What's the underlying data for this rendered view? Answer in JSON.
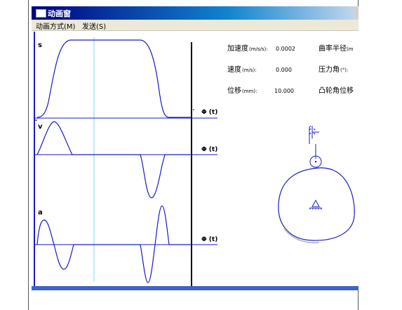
{
  "window": {
    "title": "动画窗"
  },
  "menu": {
    "items": [
      "动画方式(M)",
      "发送(S)"
    ]
  },
  "graphs": {
    "s_label": "s",
    "v_label": "v",
    "a_label": "a",
    "axis_label": "Φ (t)"
  },
  "readouts": {
    "accel": {
      "label": "加速度",
      "unit": "(m/s/s):",
      "value": "0.0002"
    },
    "speed": {
      "label": "速度",
      "unit": "(m/s):",
      "value": "0.000"
    },
    "disp": {
      "label": "位移",
      "unit": "(mm):",
      "value": "10.000"
    },
    "curvature": {
      "label": "曲率半径",
      "unit": "(m"
    },
    "pressure": {
      "label": "压力角",
      "unit": "(°):"
    },
    "cam_disp": {
      "label": "凸轮角位移"
    }
  },
  "colors": {
    "curve": "#1a1ac8",
    "axis": "#1a1ac8",
    "cursor": "#7fd4e8",
    "title_start": "#000080"
  }
}
